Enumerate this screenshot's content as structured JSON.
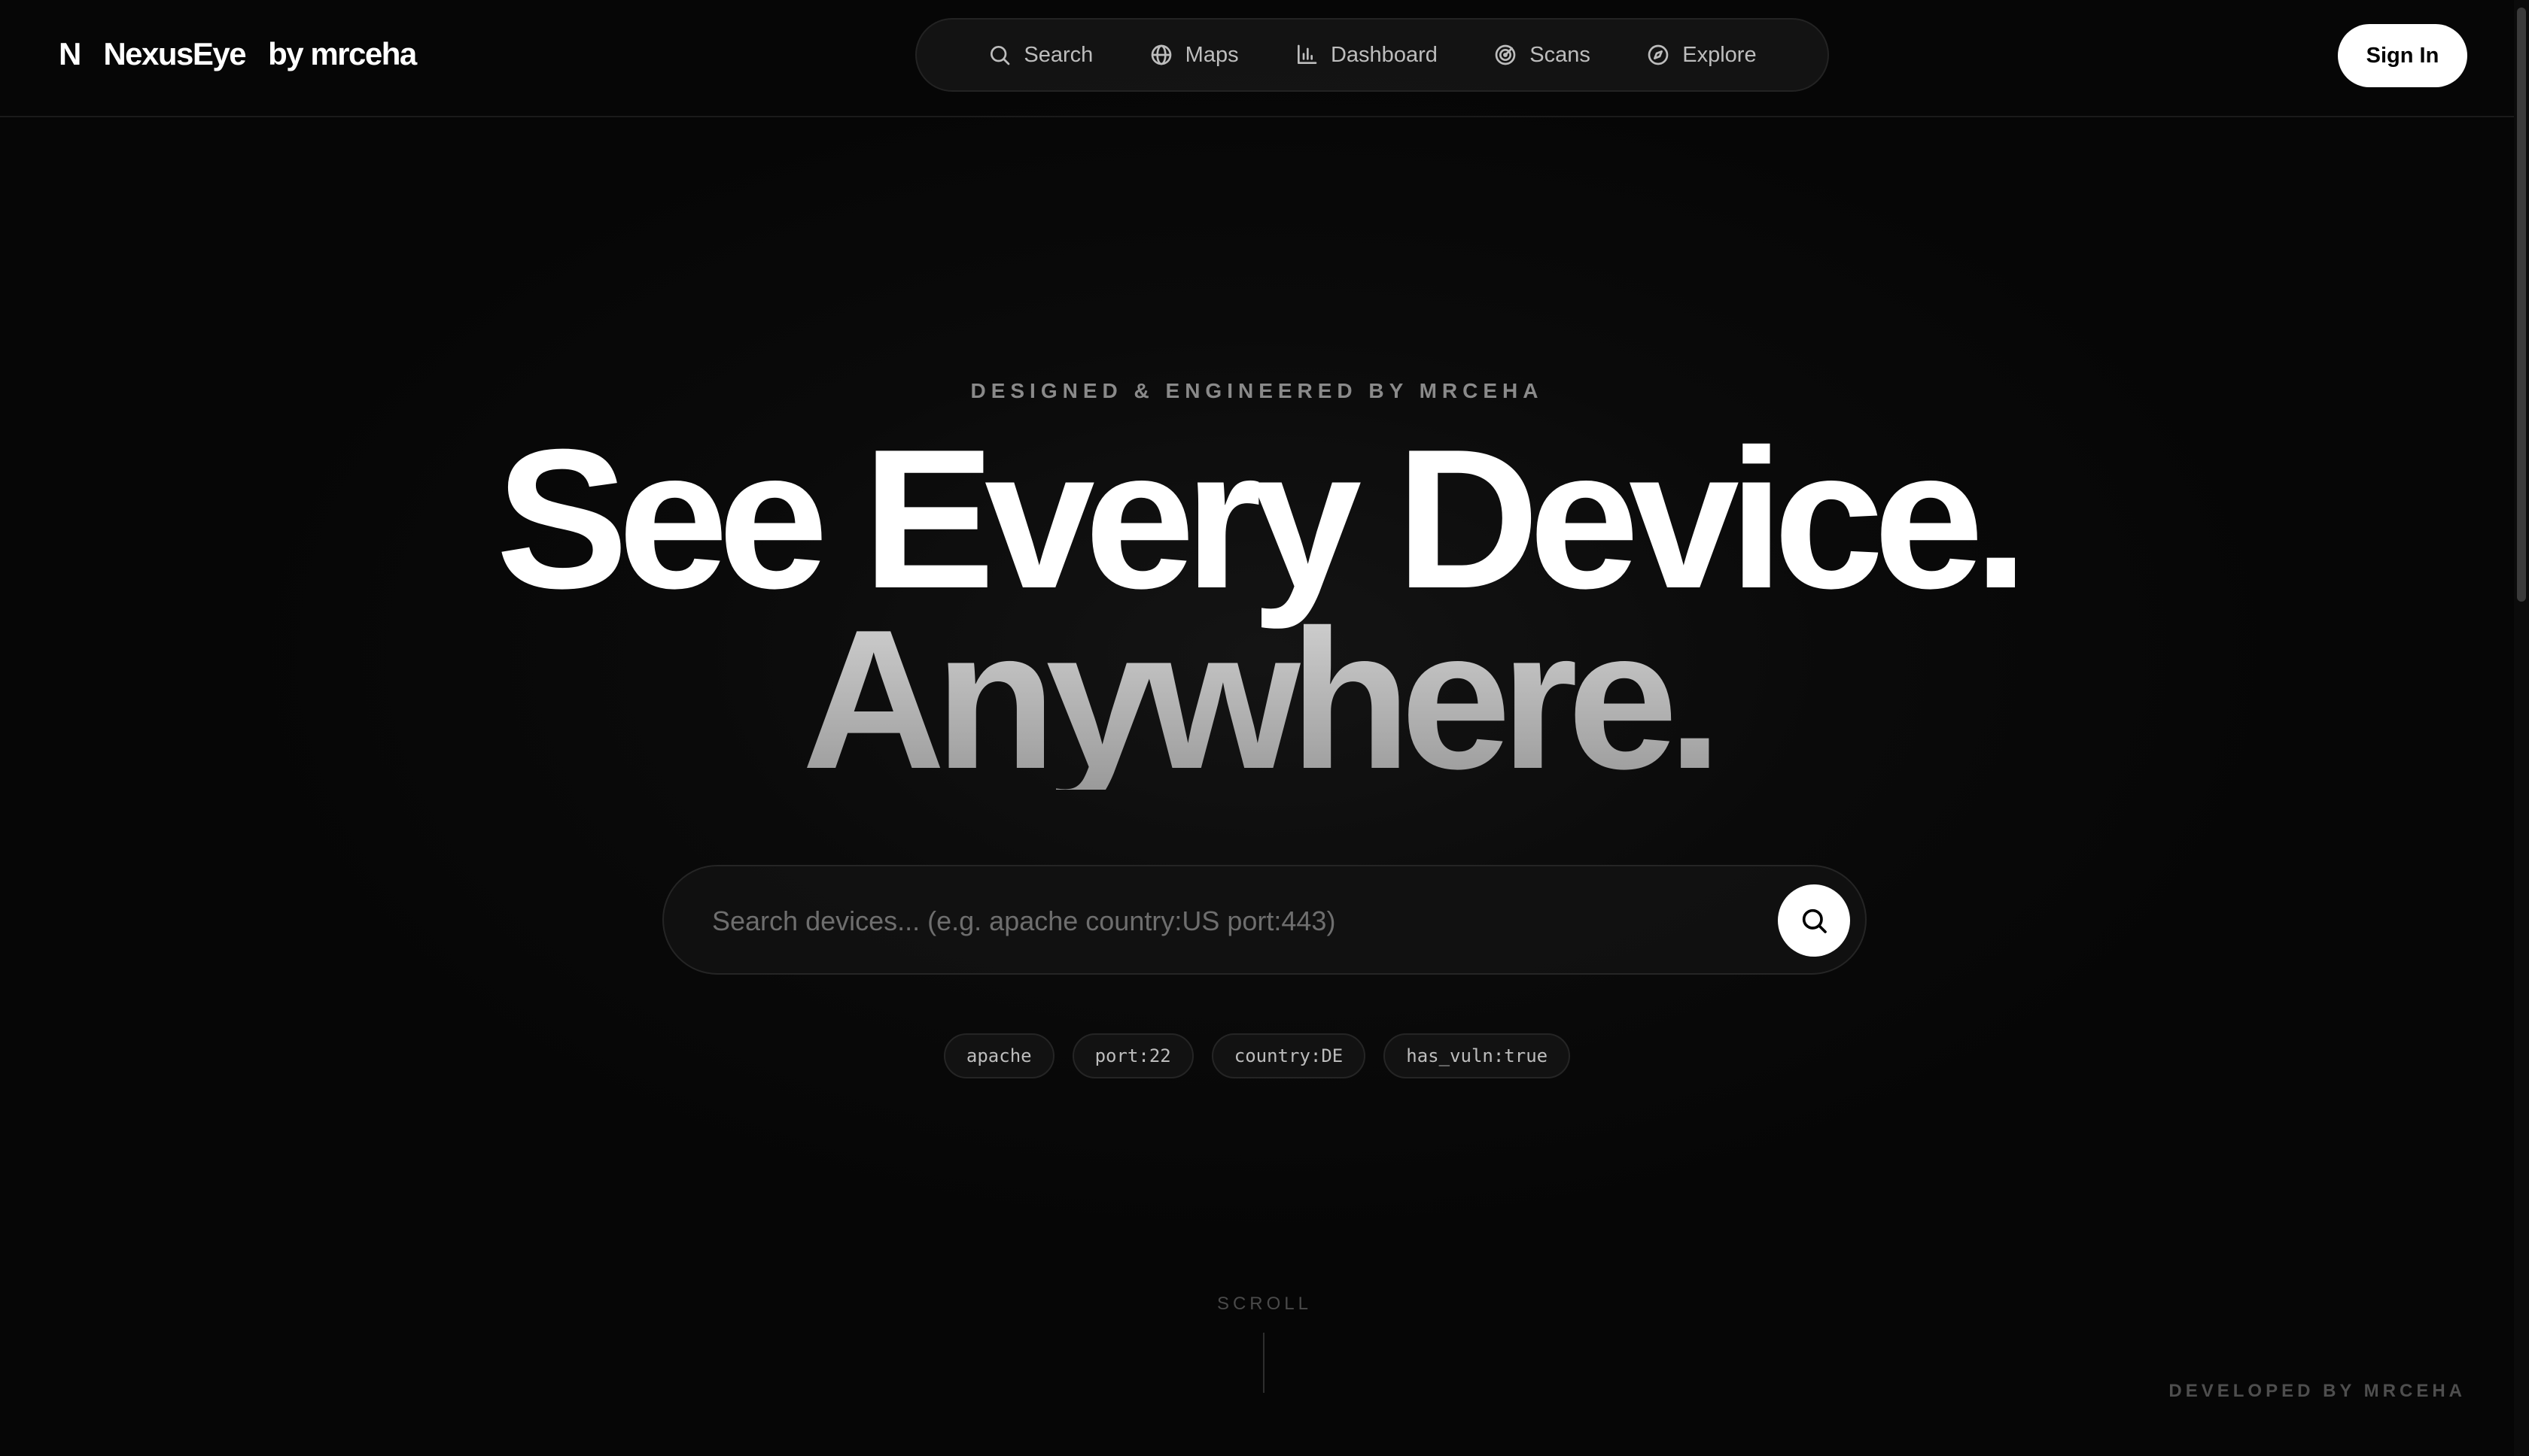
{
  "brand": {
    "mark": "N",
    "name": "NexusEye",
    "by": "by mrceha"
  },
  "nav": {
    "items": [
      {
        "label": "Search",
        "icon": "search-icon"
      },
      {
        "label": "Maps",
        "icon": "globe-icon"
      },
      {
        "label": "Dashboard",
        "icon": "bar-chart-icon"
      },
      {
        "label": "Scans",
        "icon": "radar-icon"
      },
      {
        "label": "Explore",
        "icon": "compass-icon"
      }
    ]
  },
  "header": {
    "signin_label": "Sign In"
  },
  "hero": {
    "eyebrow": "DESIGNED & ENGINEERED BY MRCEHA",
    "headline_line1": "See Every Device.",
    "headline_line2": "Anywhere.",
    "search": {
      "placeholder": "Search devices... (e.g. apache country:US port:443)",
      "value": ""
    },
    "chips": [
      "apache",
      "port:22",
      "country:DE",
      "has_vuln:true"
    ]
  },
  "scroll_label": "SCROLL",
  "footer": {
    "credit": "DEVELOPED BY MRCEHA"
  },
  "colors": {
    "background": "#070707",
    "text": "#ffffff",
    "muted": "#8a8a8a",
    "accent_button": "#ffffff"
  }
}
